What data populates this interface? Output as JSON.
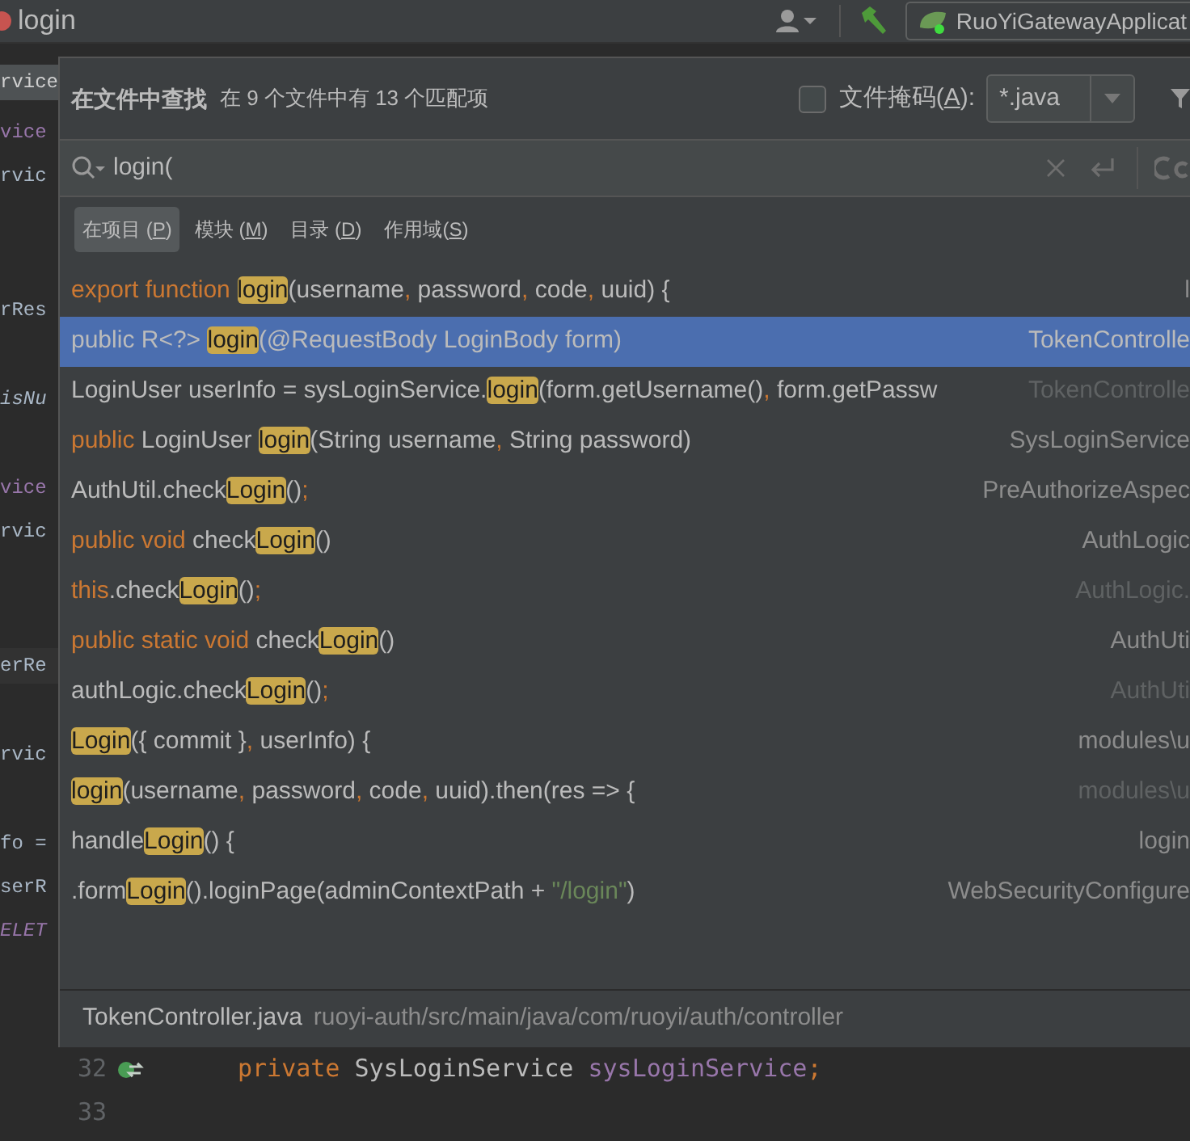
{
  "title_bar": {
    "file": "login",
    "run_config": "RuoYiGatewayApplicat"
  },
  "editor_left": [
    {
      "text": "rvice",
      "kind": "tab"
    },
    {
      "text": "vice",
      "kind": "field"
    },
    {
      "text": "rvic",
      "kind": "plain"
    },
    {
      "text": "rRes",
      "kind": "plain"
    },
    {
      "text": "isNu",
      "kind": "italic"
    },
    {
      "text": "vice",
      "kind": "field"
    },
    {
      "text": "rvic",
      "kind": "plain"
    },
    {
      "text": "erRe",
      "kind": "current"
    },
    {
      "text": "rvic",
      "kind": "plain"
    },
    {
      "text": "fo =",
      "kind": "plain"
    },
    {
      "text": "serR",
      "kind": "plain"
    },
    {
      "text": "ELET",
      "kind": "italic_field"
    }
  ],
  "find": {
    "title": "在文件中查找",
    "summary": "在 9 个文件中有 13 个匹配项",
    "file_mask": {
      "checked": false,
      "prefix": "文件掩码(",
      "mnemonic": "A",
      "suffix": "):",
      "value": "*.java"
    },
    "query": "login(",
    "scopes": [
      {
        "prefix": "在项目 (",
        "mnemonic": "P",
        "suffix": ")",
        "selected": true
      },
      {
        "prefix": "模块 (",
        "mnemonic": "M",
        "suffix": ")",
        "selected": false
      },
      {
        "prefix": "目录 (",
        "mnemonic": "D",
        "suffix": ")",
        "selected": false
      },
      {
        "prefix": "作用域(",
        "mnemonic": "S",
        "suffix": ")",
        "selected": false
      }
    ],
    "results": [
      {
        "selected": false,
        "file": "l",
        "file_dim": false,
        "parts": [
          {
            "kind": "keyword",
            "text": "export function "
          },
          {
            "kind": "match",
            "text": "login"
          },
          {
            "kind": "plain",
            "text": "(username"
          },
          {
            "kind": "keyword",
            "text": ","
          },
          {
            "kind": "plain",
            "text": " password"
          },
          {
            "kind": "keyword",
            "text": ","
          },
          {
            "kind": "plain",
            "text": " code"
          },
          {
            "kind": "keyword",
            "text": ","
          },
          {
            "kind": "plain",
            "text": " uuid) {"
          }
        ]
      },
      {
        "selected": true,
        "file": "TokenControlle",
        "file_dim": false,
        "parts": [
          {
            "kind": "plain",
            "text": "public R<?> "
          },
          {
            "kind": "match",
            "text": "login"
          },
          {
            "kind": "plain",
            "text": "(@RequestBody LoginBody form)"
          }
        ]
      },
      {
        "selected": false,
        "file": "TokenControlle",
        "file_dim": true,
        "parts": [
          {
            "kind": "plain",
            "text": "LoginUser userInfo = sysLoginService."
          },
          {
            "kind": "match",
            "text": "login"
          },
          {
            "kind": "plain",
            "text": "(form.getUsername()"
          },
          {
            "kind": "keyword",
            "text": ","
          },
          {
            "kind": "plain",
            "text": " form.getPassw"
          }
        ]
      },
      {
        "selected": false,
        "file": "SysLoginService",
        "file_dim": false,
        "parts": [
          {
            "kind": "keyword",
            "text": "public "
          },
          {
            "kind": "plain",
            "text": "LoginUser "
          },
          {
            "kind": "match",
            "text": "login"
          },
          {
            "kind": "plain",
            "text": "(String username"
          },
          {
            "kind": "keyword",
            "text": ","
          },
          {
            "kind": "plain",
            "text": " String password)"
          }
        ]
      },
      {
        "selected": false,
        "file": "PreAuthorizeAspec",
        "file_dim": false,
        "parts": [
          {
            "kind": "plain",
            "text": "AuthUtil.check"
          },
          {
            "kind": "match",
            "text": "Login"
          },
          {
            "kind": "plain",
            "text": "()"
          },
          {
            "kind": "keyword",
            "text": ";"
          }
        ]
      },
      {
        "selected": false,
        "file": "AuthLogic",
        "file_dim": false,
        "parts": [
          {
            "kind": "keyword",
            "text": "public void "
          },
          {
            "kind": "plain",
            "text": "check"
          },
          {
            "kind": "match",
            "text": "Login"
          },
          {
            "kind": "plain",
            "text": "()"
          }
        ]
      },
      {
        "selected": false,
        "file": "AuthLogic.",
        "file_dim": true,
        "parts": [
          {
            "kind": "keyword",
            "text": "this"
          },
          {
            "kind": "plain",
            "text": ".check"
          },
          {
            "kind": "match",
            "text": "Login"
          },
          {
            "kind": "plain",
            "text": "()"
          },
          {
            "kind": "keyword",
            "text": ";"
          }
        ]
      },
      {
        "selected": false,
        "file": "AuthUti",
        "file_dim": false,
        "parts": [
          {
            "kind": "keyword",
            "text": "public static void "
          },
          {
            "kind": "plain",
            "text": "check"
          },
          {
            "kind": "match",
            "text": "Login"
          },
          {
            "kind": "plain",
            "text": "()"
          }
        ]
      },
      {
        "selected": false,
        "file": "AuthUti",
        "file_dim": true,
        "parts": [
          {
            "kind": "plain",
            "text": "authLogic.check"
          },
          {
            "kind": "match",
            "text": "Login"
          },
          {
            "kind": "plain",
            "text": "()"
          },
          {
            "kind": "keyword",
            "text": ";"
          }
        ]
      },
      {
        "selected": false,
        "file": "modules\\u",
        "file_dim": false,
        "parts": [
          {
            "kind": "match",
            "text": "Login"
          },
          {
            "kind": "plain",
            "text": "({ commit }"
          },
          {
            "kind": "keyword",
            "text": ","
          },
          {
            "kind": "plain",
            "text": " userInfo) {"
          }
        ]
      },
      {
        "selected": false,
        "file": "modules\\u",
        "file_dim": true,
        "parts": [
          {
            "kind": "match",
            "text": "login"
          },
          {
            "kind": "plain",
            "text": "(username"
          },
          {
            "kind": "keyword",
            "text": ","
          },
          {
            "kind": "plain",
            "text": " password"
          },
          {
            "kind": "keyword",
            "text": ","
          },
          {
            "kind": "plain",
            "text": " code"
          },
          {
            "kind": "keyword",
            "text": ","
          },
          {
            "kind": "plain",
            "text": " uuid).then(res => {"
          }
        ]
      },
      {
        "selected": false,
        "file": "login",
        "file_dim": false,
        "parts": [
          {
            "kind": "plain",
            "text": "handle"
          },
          {
            "kind": "match",
            "text": "Login"
          },
          {
            "kind": "plain",
            "text": "() {"
          }
        ]
      },
      {
        "selected": false,
        "file": "WebSecurityConfigure",
        "file_dim": false,
        "parts": [
          {
            "kind": "plain",
            "text": ".form"
          },
          {
            "kind": "match",
            "text": "Login"
          },
          {
            "kind": "plain",
            "text": "().loginPage(adminContextPath + "
          },
          {
            "kind": "string",
            "text": "\"/login\""
          },
          {
            "kind": "plain",
            "text": ")"
          }
        ]
      }
    ],
    "preview": {
      "file": "TokenController.java",
      "path": "ruoyi-auth/src/main/java/com/ruoyi/auth/controller"
    }
  },
  "editor_bottom": [
    {
      "number": "32",
      "parts": [
        {
          "kind": "keyword",
          "text": "private "
        },
        {
          "kind": "plain",
          "text": "SysLoginService "
        },
        {
          "kind": "field",
          "text": "sysLoginService"
        },
        {
          "kind": "keyword",
          "text": ";"
        }
      ],
      "icon": true
    },
    {
      "number": "33",
      "icon": false
    }
  ]
}
